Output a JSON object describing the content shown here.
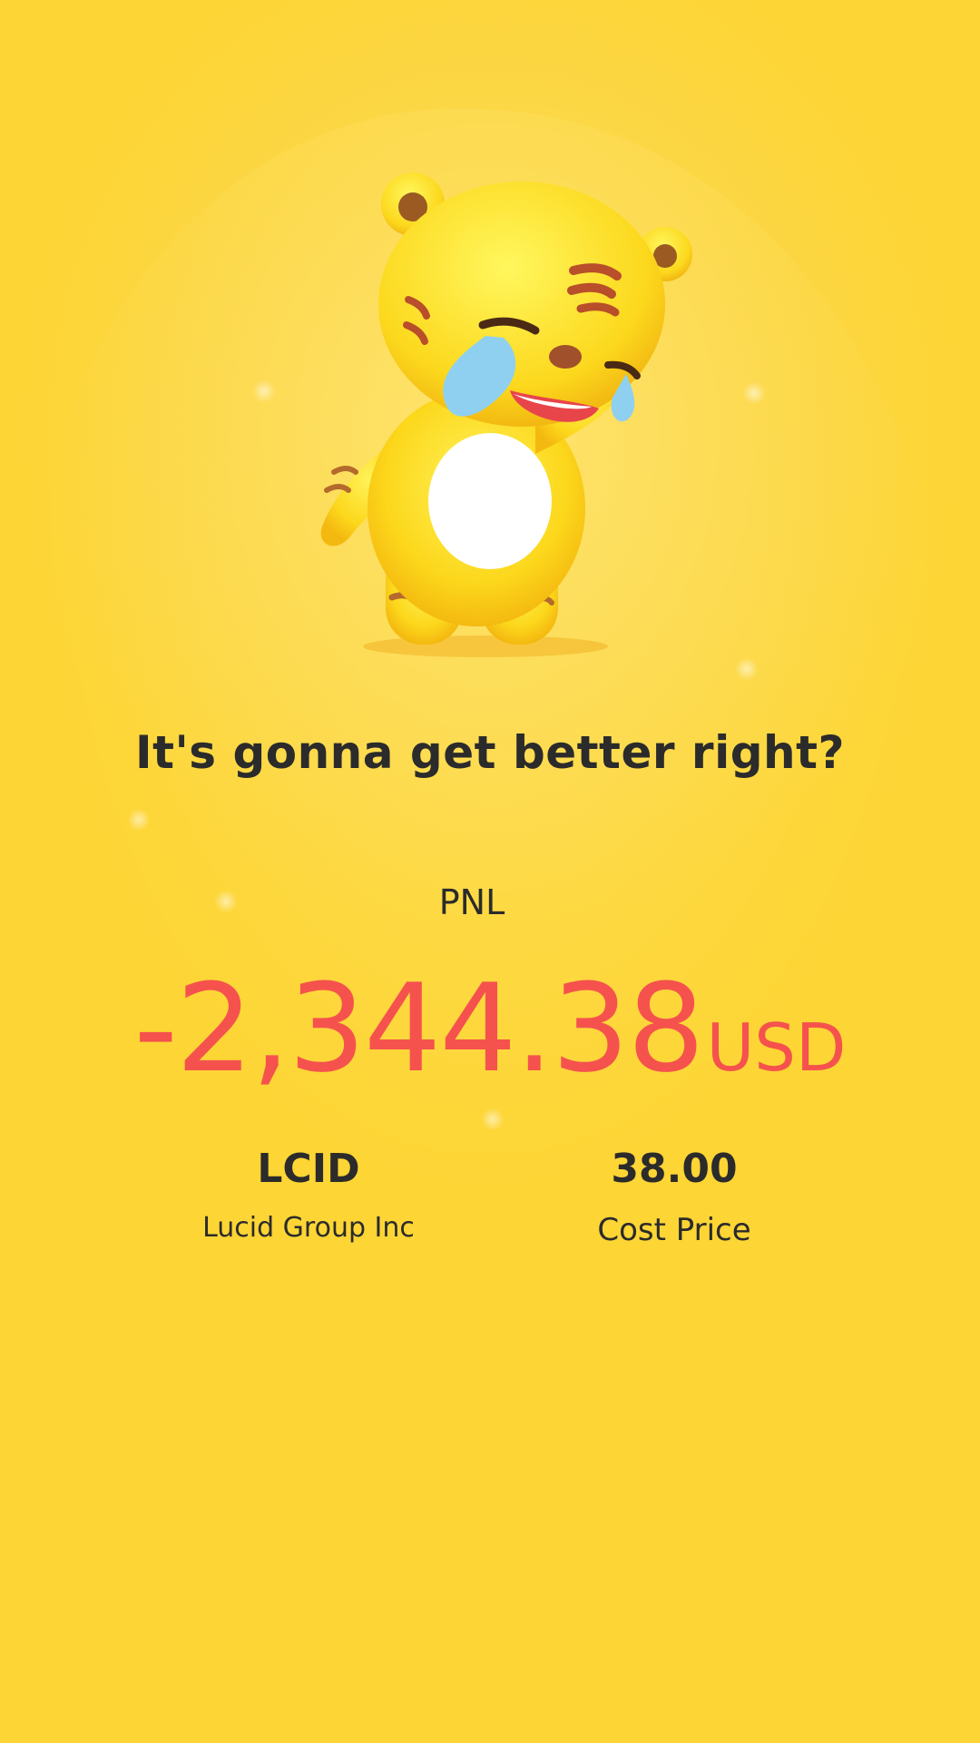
{
  "headline": "It's gonna get better right?",
  "pnl": {
    "label": "PNL",
    "amount": "-2,344.38",
    "currency": "USD",
    "color": "#f5524e"
  },
  "stock": {
    "ticker": "LCID",
    "name": "Lucid Group Inc"
  },
  "cost": {
    "value": "38.00",
    "label": "Cost Price"
  },
  "mascot": {
    "icon": "crying-tiger-mascot-icon"
  },
  "colors": {
    "background": "#fdd535",
    "text": "#2b2b2b"
  }
}
